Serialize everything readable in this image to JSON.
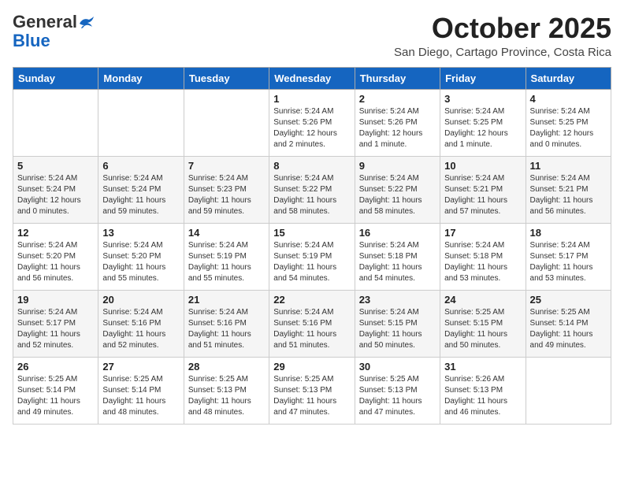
{
  "header": {
    "logo_line1": "General",
    "logo_line2": "Blue",
    "month": "October 2025",
    "location": "San Diego, Cartago Province, Costa Rica"
  },
  "weekdays": [
    "Sunday",
    "Monday",
    "Tuesday",
    "Wednesday",
    "Thursday",
    "Friday",
    "Saturday"
  ],
  "weeks": [
    [
      {
        "day": "",
        "info": ""
      },
      {
        "day": "",
        "info": ""
      },
      {
        "day": "",
        "info": ""
      },
      {
        "day": "1",
        "info": "Sunrise: 5:24 AM\nSunset: 5:26 PM\nDaylight: 12 hours\nand 2 minutes."
      },
      {
        "day": "2",
        "info": "Sunrise: 5:24 AM\nSunset: 5:26 PM\nDaylight: 12 hours\nand 1 minute."
      },
      {
        "day": "3",
        "info": "Sunrise: 5:24 AM\nSunset: 5:25 PM\nDaylight: 12 hours\nand 1 minute."
      },
      {
        "day": "4",
        "info": "Sunrise: 5:24 AM\nSunset: 5:25 PM\nDaylight: 12 hours\nand 0 minutes."
      }
    ],
    [
      {
        "day": "5",
        "info": "Sunrise: 5:24 AM\nSunset: 5:24 PM\nDaylight: 12 hours\nand 0 minutes."
      },
      {
        "day": "6",
        "info": "Sunrise: 5:24 AM\nSunset: 5:24 PM\nDaylight: 11 hours\nand 59 minutes."
      },
      {
        "day": "7",
        "info": "Sunrise: 5:24 AM\nSunset: 5:23 PM\nDaylight: 11 hours\nand 59 minutes."
      },
      {
        "day": "8",
        "info": "Sunrise: 5:24 AM\nSunset: 5:22 PM\nDaylight: 11 hours\nand 58 minutes."
      },
      {
        "day": "9",
        "info": "Sunrise: 5:24 AM\nSunset: 5:22 PM\nDaylight: 11 hours\nand 58 minutes."
      },
      {
        "day": "10",
        "info": "Sunrise: 5:24 AM\nSunset: 5:21 PM\nDaylight: 11 hours\nand 57 minutes."
      },
      {
        "day": "11",
        "info": "Sunrise: 5:24 AM\nSunset: 5:21 PM\nDaylight: 11 hours\nand 56 minutes."
      }
    ],
    [
      {
        "day": "12",
        "info": "Sunrise: 5:24 AM\nSunset: 5:20 PM\nDaylight: 11 hours\nand 56 minutes."
      },
      {
        "day": "13",
        "info": "Sunrise: 5:24 AM\nSunset: 5:20 PM\nDaylight: 11 hours\nand 55 minutes."
      },
      {
        "day": "14",
        "info": "Sunrise: 5:24 AM\nSunset: 5:19 PM\nDaylight: 11 hours\nand 55 minutes."
      },
      {
        "day": "15",
        "info": "Sunrise: 5:24 AM\nSunset: 5:19 PM\nDaylight: 11 hours\nand 54 minutes."
      },
      {
        "day": "16",
        "info": "Sunrise: 5:24 AM\nSunset: 5:18 PM\nDaylight: 11 hours\nand 54 minutes."
      },
      {
        "day": "17",
        "info": "Sunrise: 5:24 AM\nSunset: 5:18 PM\nDaylight: 11 hours\nand 53 minutes."
      },
      {
        "day": "18",
        "info": "Sunrise: 5:24 AM\nSunset: 5:17 PM\nDaylight: 11 hours\nand 53 minutes."
      }
    ],
    [
      {
        "day": "19",
        "info": "Sunrise: 5:24 AM\nSunset: 5:17 PM\nDaylight: 11 hours\nand 52 minutes."
      },
      {
        "day": "20",
        "info": "Sunrise: 5:24 AM\nSunset: 5:16 PM\nDaylight: 11 hours\nand 52 minutes."
      },
      {
        "day": "21",
        "info": "Sunrise: 5:24 AM\nSunset: 5:16 PM\nDaylight: 11 hours\nand 51 minutes."
      },
      {
        "day": "22",
        "info": "Sunrise: 5:24 AM\nSunset: 5:16 PM\nDaylight: 11 hours\nand 51 minutes."
      },
      {
        "day": "23",
        "info": "Sunrise: 5:24 AM\nSunset: 5:15 PM\nDaylight: 11 hours\nand 50 minutes."
      },
      {
        "day": "24",
        "info": "Sunrise: 5:25 AM\nSunset: 5:15 PM\nDaylight: 11 hours\nand 50 minutes."
      },
      {
        "day": "25",
        "info": "Sunrise: 5:25 AM\nSunset: 5:14 PM\nDaylight: 11 hours\nand 49 minutes."
      }
    ],
    [
      {
        "day": "26",
        "info": "Sunrise: 5:25 AM\nSunset: 5:14 PM\nDaylight: 11 hours\nand 49 minutes."
      },
      {
        "day": "27",
        "info": "Sunrise: 5:25 AM\nSunset: 5:14 PM\nDaylight: 11 hours\nand 48 minutes."
      },
      {
        "day": "28",
        "info": "Sunrise: 5:25 AM\nSunset: 5:13 PM\nDaylight: 11 hours\nand 48 minutes."
      },
      {
        "day": "29",
        "info": "Sunrise: 5:25 AM\nSunset: 5:13 PM\nDaylight: 11 hours\nand 47 minutes."
      },
      {
        "day": "30",
        "info": "Sunrise: 5:25 AM\nSunset: 5:13 PM\nDaylight: 11 hours\nand 47 minutes."
      },
      {
        "day": "31",
        "info": "Sunrise: 5:26 AM\nSunset: 5:13 PM\nDaylight: 11 hours\nand 46 minutes."
      },
      {
        "day": "",
        "info": ""
      }
    ]
  ]
}
